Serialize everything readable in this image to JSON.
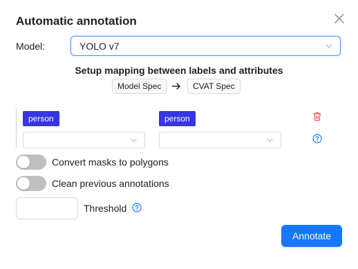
{
  "dialog": {
    "title": "Automatic annotation"
  },
  "model": {
    "label": "Model:",
    "selected": "YOLO v7"
  },
  "mapping": {
    "heading": "Setup mapping between labels and attributes",
    "source_tag": "Model Spec",
    "target_tag": "CVAT Spec",
    "rows": [
      {
        "model_label": "person",
        "cvat_label": "person",
        "model_attribute": "",
        "cvat_attribute": ""
      }
    ]
  },
  "options": {
    "convert_masks": {
      "label": "Convert masks to polygons",
      "enabled": false
    },
    "clean_previous": {
      "label": "Clean previous annotations",
      "enabled": false
    }
  },
  "threshold": {
    "label": "Threshold",
    "value": ""
  },
  "actions": {
    "annotate_label": "Annotate"
  },
  "colors": {
    "primary": "#1677ff",
    "label_chip": "#3535e6",
    "danger": "#ff4d4f",
    "toggle_off": "#bfbfbf"
  },
  "icons": {
    "close": "close-icon",
    "dropdown": "chevron-down-icon",
    "arrow": "arrow-right-icon",
    "delete": "trash-icon",
    "help": "question-circle-icon"
  }
}
